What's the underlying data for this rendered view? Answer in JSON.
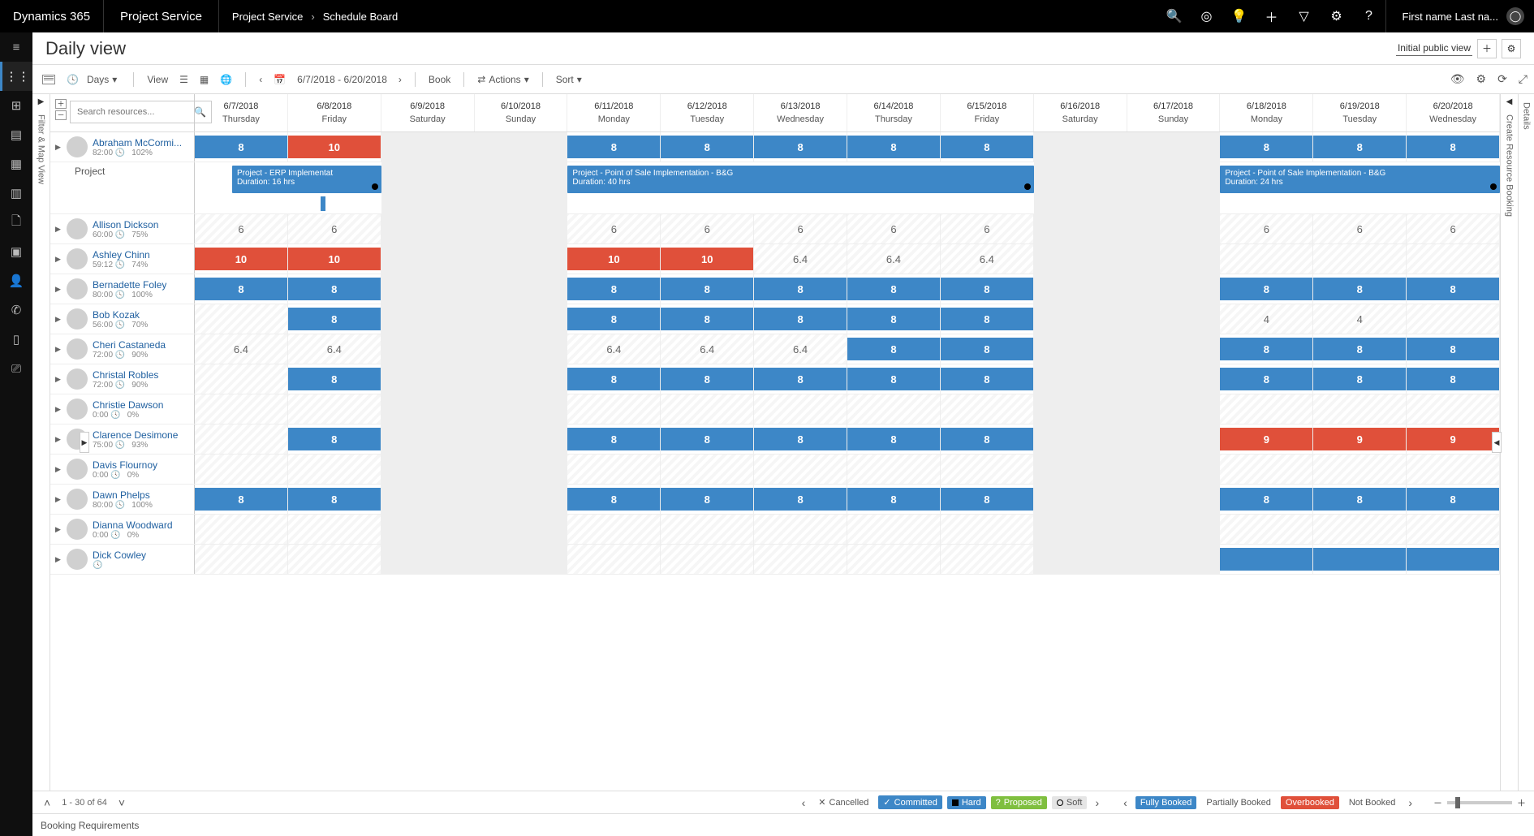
{
  "topbar": {
    "brand": "Dynamics 365",
    "app": "Project Service",
    "crumbs": [
      "Project Service",
      "Schedule Board"
    ],
    "user": "First name Last na..."
  },
  "title": "Daily view",
  "view_tab": "Initial public view",
  "toolbar": {
    "mode": "Days",
    "view_label": "View",
    "range": "6/7/2018 - 6/20/2018",
    "book": "Book",
    "actions": "Actions",
    "sort": "Sort"
  },
  "filter_strip": "Filter & Map View",
  "right_strip": "Create Resource Booking",
  "right_strip2": "Details",
  "search_placeholder": "Search resources...",
  "dates": [
    {
      "d": "6/7/2018",
      "w": "Thursday"
    },
    {
      "d": "6/8/2018",
      "w": "Friday"
    },
    {
      "d": "6/9/2018",
      "w": "Saturday"
    },
    {
      "d": "6/10/2018",
      "w": "Sunday"
    },
    {
      "d": "6/11/2018",
      "w": "Monday"
    },
    {
      "d": "6/12/2018",
      "w": "Tuesday"
    },
    {
      "d": "6/13/2018",
      "w": "Wednesday"
    },
    {
      "d": "6/14/2018",
      "w": "Thursday"
    },
    {
      "d": "6/15/2018",
      "w": "Friday"
    },
    {
      "d": "6/16/2018",
      "w": "Saturday"
    },
    {
      "d": "6/17/2018",
      "w": "Sunday"
    },
    {
      "d": "6/18/2018",
      "w": "Monday"
    },
    {
      "d": "6/19/2018",
      "w": "Tuesday"
    },
    {
      "d": "6/20/2018",
      "w": "Wednesday"
    }
  ],
  "weekend_idx": [
    2,
    3,
    9,
    10
  ],
  "tasks": {
    "group_label": "Project",
    "a": {
      "title": "Project - ERP Implementat",
      "dur": "Duration: 16 hrs"
    },
    "b": {
      "title": "Project - Point of Sale Implementation - B&G",
      "dur": "Duration: 40 hrs"
    },
    "c": {
      "title": "Project - Point of Sale Implementation - B&G",
      "dur": "Duration: 24 hrs"
    }
  },
  "resources": [
    {
      "name": "Abraham McCormi...",
      "hrs": "82:00",
      "pct": "102%",
      "cells": [
        {
          "t": "b",
          "v": "8"
        },
        {
          "t": "r",
          "v": "10"
        },
        {
          "t": "we"
        },
        {
          "t": "we"
        },
        {
          "t": "b",
          "v": "8"
        },
        {
          "t": "b",
          "v": "8"
        },
        {
          "t": "b",
          "v": "8"
        },
        {
          "t": "b",
          "v": "8"
        },
        {
          "t": "b",
          "v": "8"
        },
        {
          "t": "we"
        },
        {
          "t": "we"
        },
        {
          "t": "b",
          "v": "8"
        },
        {
          "t": "b",
          "v": "8"
        },
        {
          "t": "b",
          "v": "8"
        }
      ],
      "expanded": true
    },
    {
      "name": "Allison Dickson",
      "hrs": "60:00",
      "pct": "75%",
      "cells": [
        {
          "t": "n",
          "v": "6"
        },
        {
          "t": "n",
          "v": "6"
        },
        {
          "t": "we"
        },
        {
          "t": "we"
        },
        {
          "t": "n",
          "v": "6"
        },
        {
          "t": "n",
          "v": "6"
        },
        {
          "t": "n",
          "v": "6"
        },
        {
          "t": "n",
          "v": "6"
        },
        {
          "t": "n",
          "v": "6"
        },
        {
          "t": "we"
        },
        {
          "t": "we"
        },
        {
          "t": "n",
          "v": "6"
        },
        {
          "t": "n",
          "v": "6"
        },
        {
          "t": "n",
          "v": "6"
        }
      ]
    },
    {
      "name": "Ashley Chinn",
      "hrs": "59:12",
      "pct": "74%",
      "cells": [
        {
          "t": "r",
          "v": "10"
        },
        {
          "t": "r",
          "v": "10"
        },
        {
          "t": "we"
        },
        {
          "t": "we"
        },
        {
          "t": "r",
          "v": "10"
        },
        {
          "t": "r",
          "v": "10"
        },
        {
          "t": "n",
          "v": "6.4"
        },
        {
          "t": "n",
          "v": "6.4"
        },
        {
          "t": "n",
          "v": "6.4"
        },
        {
          "t": "we"
        },
        {
          "t": "we"
        },
        {
          "t": "e"
        },
        {
          "t": "e"
        },
        {
          "t": "e"
        }
      ]
    },
    {
      "name": "Bernadette Foley",
      "hrs": "80:00",
      "pct": "100%",
      "cells": [
        {
          "t": "b",
          "v": "8"
        },
        {
          "t": "b",
          "v": "8"
        },
        {
          "t": "we"
        },
        {
          "t": "we"
        },
        {
          "t": "b",
          "v": "8"
        },
        {
          "t": "b",
          "v": "8"
        },
        {
          "t": "b",
          "v": "8"
        },
        {
          "t": "b",
          "v": "8"
        },
        {
          "t": "b",
          "v": "8"
        },
        {
          "t": "we"
        },
        {
          "t": "we"
        },
        {
          "t": "b",
          "v": "8"
        },
        {
          "t": "b",
          "v": "8"
        },
        {
          "t": "b",
          "v": "8"
        }
      ]
    },
    {
      "name": "Bob Kozak",
      "hrs": "56:00",
      "pct": "70%",
      "cells": [
        {
          "t": "e"
        },
        {
          "t": "b",
          "v": "8"
        },
        {
          "t": "we"
        },
        {
          "t": "we"
        },
        {
          "t": "b",
          "v": "8"
        },
        {
          "t": "b",
          "v": "8"
        },
        {
          "t": "b",
          "v": "8"
        },
        {
          "t": "b",
          "v": "8"
        },
        {
          "t": "b",
          "v": "8"
        },
        {
          "t": "we"
        },
        {
          "t": "we"
        },
        {
          "t": "n",
          "v": "4"
        },
        {
          "t": "n",
          "v": "4"
        },
        {
          "t": "e"
        }
      ]
    },
    {
      "name": "Cheri Castaneda",
      "hrs": "72:00",
      "pct": "90%",
      "cells": [
        {
          "t": "n",
          "v": "6.4"
        },
        {
          "t": "n",
          "v": "6.4"
        },
        {
          "t": "we"
        },
        {
          "t": "we"
        },
        {
          "t": "n",
          "v": "6.4"
        },
        {
          "t": "n",
          "v": "6.4"
        },
        {
          "t": "n",
          "v": "6.4"
        },
        {
          "t": "b",
          "v": "8"
        },
        {
          "t": "b",
          "v": "8"
        },
        {
          "t": "we"
        },
        {
          "t": "we"
        },
        {
          "t": "b",
          "v": "8"
        },
        {
          "t": "b",
          "v": "8"
        },
        {
          "t": "b",
          "v": "8"
        }
      ]
    },
    {
      "name": "Christal Robles",
      "hrs": "72:00",
      "pct": "90%",
      "cells": [
        {
          "t": "e"
        },
        {
          "t": "b",
          "v": "8"
        },
        {
          "t": "we"
        },
        {
          "t": "we"
        },
        {
          "t": "b",
          "v": "8"
        },
        {
          "t": "b",
          "v": "8"
        },
        {
          "t": "b",
          "v": "8"
        },
        {
          "t": "b",
          "v": "8"
        },
        {
          "t": "b",
          "v": "8"
        },
        {
          "t": "we"
        },
        {
          "t": "we"
        },
        {
          "t": "b",
          "v": "8"
        },
        {
          "t": "b",
          "v": "8"
        },
        {
          "t": "b",
          "v": "8"
        }
      ]
    },
    {
      "name": "Christie Dawson",
      "hrs": "0:00",
      "pct": "0%",
      "cells": [
        {
          "t": "e"
        },
        {
          "t": "e"
        },
        {
          "t": "we"
        },
        {
          "t": "we"
        },
        {
          "t": "e"
        },
        {
          "t": "e"
        },
        {
          "t": "e"
        },
        {
          "t": "e"
        },
        {
          "t": "e"
        },
        {
          "t": "we"
        },
        {
          "t": "we"
        },
        {
          "t": "e"
        },
        {
          "t": "e"
        },
        {
          "t": "e"
        }
      ]
    },
    {
      "name": "Clarence Desimone",
      "hrs": "75:00",
      "pct": "93%",
      "cells": [
        {
          "t": "e"
        },
        {
          "t": "b",
          "v": "8"
        },
        {
          "t": "we"
        },
        {
          "t": "we"
        },
        {
          "t": "b",
          "v": "8"
        },
        {
          "t": "b",
          "v": "8"
        },
        {
          "t": "b",
          "v": "8"
        },
        {
          "t": "b",
          "v": "8"
        },
        {
          "t": "b",
          "v": "8"
        },
        {
          "t": "we"
        },
        {
          "t": "we"
        },
        {
          "t": "r",
          "v": "9"
        },
        {
          "t": "r",
          "v": "9"
        },
        {
          "t": "r",
          "v": "9"
        }
      ]
    },
    {
      "name": "Davis Flournoy",
      "hrs": "0:00",
      "pct": "0%",
      "cells": [
        {
          "t": "e"
        },
        {
          "t": "e"
        },
        {
          "t": "we"
        },
        {
          "t": "we"
        },
        {
          "t": "e"
        },
        {
          "t": "e"
        },
        {
          "t": "e"
        },
        {
          "t": "e"
        },
        {
          "t": "e"
        },
        {
          "t": "we"
        },
        {
          "t": "we"
        },
        {
          "t": "e"
        },
        {
          "t": "e"
        },
        {
          "t": "e"
        }
      ]
    },
    {
      "name": "Dawn Phelps",
      "hrs": "80:00",
      "pct": "100%",
      "cells": [
        {
          "t": "b",
          "v": "8"
        },
        {
          "t": "b",
          "v": "8"
        },
        {
          "t": "we"
        },
        {
          "t": "we"
        },
        {
          "t": "b",
          "v": "8"
        },
        {
          "t": "b",
          "v": "8"
        },
        {
          "t": "b",
          "v": "8"
        },
        {
          "t": "b",
          "v": "8"
        },
        {
          "t": "b",
          "v": "8"
        },
        {
          "t": "we"
        },
        {
          "t": "we"
        },
        {
          "t": "b",
          "v": "8"
        },
        {
          "t": "b",
          "v": "8"
        },
        {
          "t": "b",
          "v": "8"
        }
      ]
    },
    {
      "name": "Dianna Woodward",
      "hrs": "0:00",
      "pct": "0%",
      "cells": [
        {
          "t": "e"
        },
        {
          "t": "e"
        },
        {
          "t": "we"
        },
        {
          "t": "we"
        },
        {
          "t": "e"
        },
        {
          "t": "e"
        },
        {
          "t": "e"
        },
        {
          "t": "e"
        },
        {
          "t": "e"
        },
        {
          "t": "we"
        },
        {
          "t": "we"
        },
        {
          "t": "e"
        },
        {
          "t": "e"
        },
        {
          "t": "e"
        }
      ]
    },
    {
      "name": "Dick Cowley",
      "hrs": "",
      "pct": "",
      "cells": [
        {
          "t": "e"
        },
        {
          "t": "e"
        },
        {
          "t": "we"
        },
        {
          "t": "we"
        },
        {
          "t": "e"
        },
        {
          "t": "e"
        },
        {
          "t": "e"
        },
        {
          "t": "e"
        },
        {
          "t": "e"
        },
        {
          "t": "we"
        },
        {
          "t": "we"
        },
        {
          "t": "b",
          "v": ""
        },
        {
          "t": "b",
          "v": ""
        },
        {
          "t": "b",
          "v": ""
        }
      ]
    }
  ],
  "legend": {
    "pag": "1 - 30 of 64",
    "cancelled": "Cancelled",
    "committed": "Committed",
    "hard": "Hard",
    "proposed": "Proposed",
    "soft": "Soft",
    "fully": "Fully Booked",
    "partially": "Partially Booked",
    "over": "Overbooked",
    "not": "Not Booked"
  },
  "booking_req": "Booking Requirements"
}
